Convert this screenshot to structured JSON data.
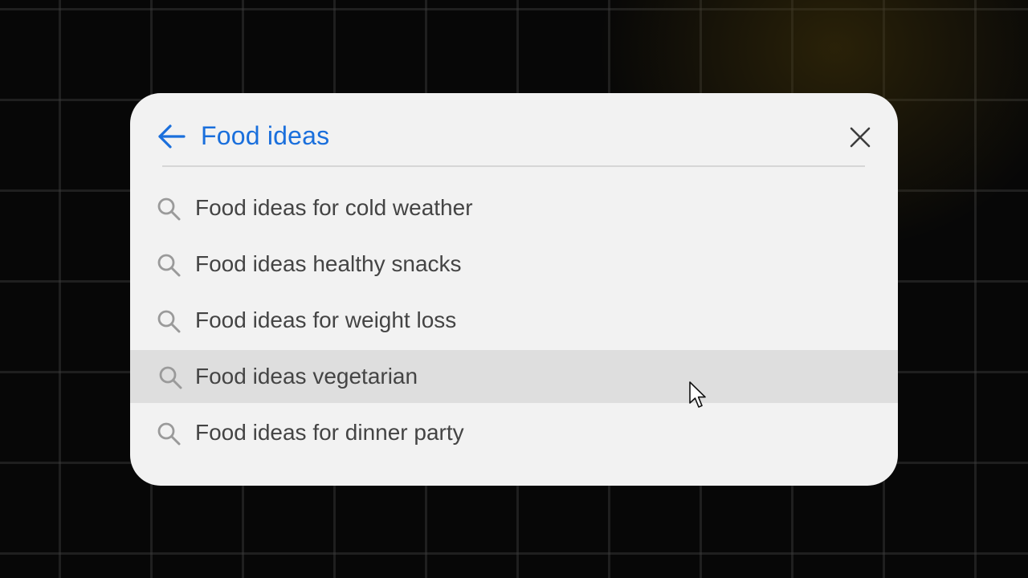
{
  "search": {
    "query": "Food ideas",
    "back_icon": "arrow-left-icon",
    "close_icon": "close-icon"
  },
  "suggestions": [
    {
      "label": "Food ideas for cold weather",
      "icon": "search-icon",
      "highlighted": false
    },
    {
      "label": "Food ideas healthy snacks",
      "icon": "search-icon",
      "highlighted": false
    },
    {
      "label": "Food ideas for weight loss",
      "icon": "search-icon",
      "highlighted": false
    },
    {
      "label": "Food ideas vegetarian",
      "icon": "search-icon",
      "highlighted": true
    },
    {
      "label": "Food ideas for dinner party",
      "icon": "search-icon",
      "highlighted": false
    }
  ],
  "colors": {
    "accent": "#1a6fdc",
    "panel": "#f2f2f2",
    "hover_row": "#dedede",
    "text": "#444444",
    "icon": "#9a9a9a"
  }
}
